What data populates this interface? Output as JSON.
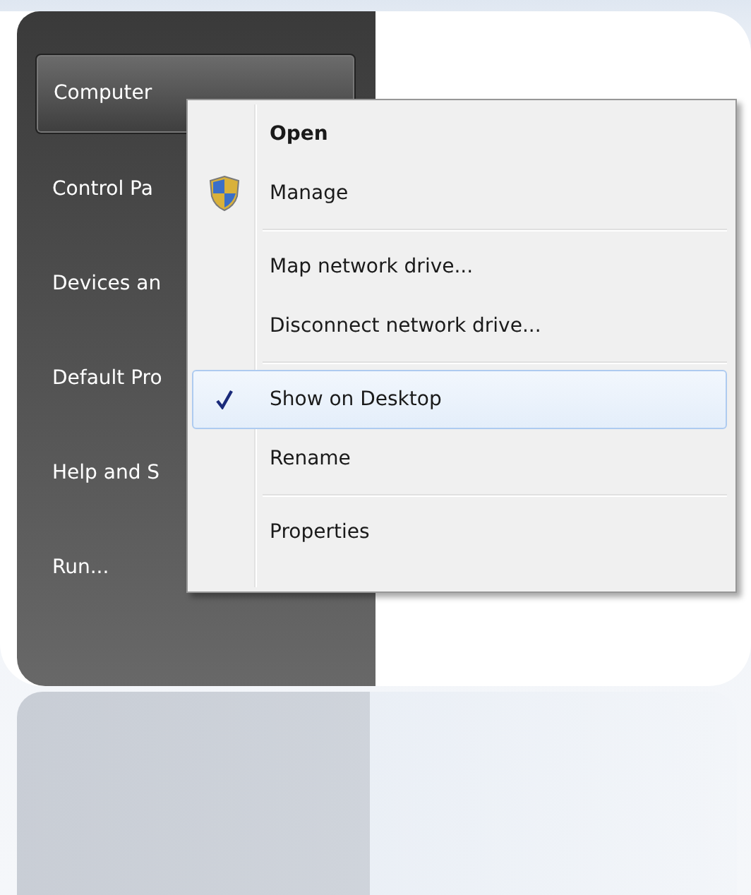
{
  "start_menu": {
    "items": [
      {
        "label": "Computer",
        "selected": true
      },
      {
        "label": "Control Pa",
        "selected": false
      },
      {
        "label": "Devices an",
        "selected": false
      },
      {
        "label": "Default Pro",
        "selected": false
      },
      {
        "label": "Help and S",
        "selected": false
      },
      {
        "label": "Run...",
        "selected": false
      }
    ]
  },
  "context_menu": {
    "groups": [
      [
        {
          "kind": "plain",
          "label": "Open",
          "default": true,
          "checked": false,
          "selected": false
        },
        {
          "kind": "shield",
          "label": "Manage",
          "default": false,
          "checked": false,
          "selected": false
        }
      ],
      [
        {
          "kind": "plain",
          "label": "Map network drive...",
          "default": false,
          "checked": false,
          "selected": false
        },
        {
          "kind": "plain",
          "label": "Disconnect network drive...",
          "default": false,
          "checked": false,
          "selected": false
        }
      ],
      [
        {
          "kind": "plain",
          "label": "Show on Desktop",
          "default": false,
          "checked": true,
          "selected": true
        },
        {
          "kind": "plain",
          "label": "Rename",
          "default": false,
          "checked": false,
          "selected": false
        }
      ],
      [
        {
          "kind": "plain",
          "label": "Properties",
          "default": false,
          "checked": false,
          "selected": false
        }
      ]
    ]
  }
}
